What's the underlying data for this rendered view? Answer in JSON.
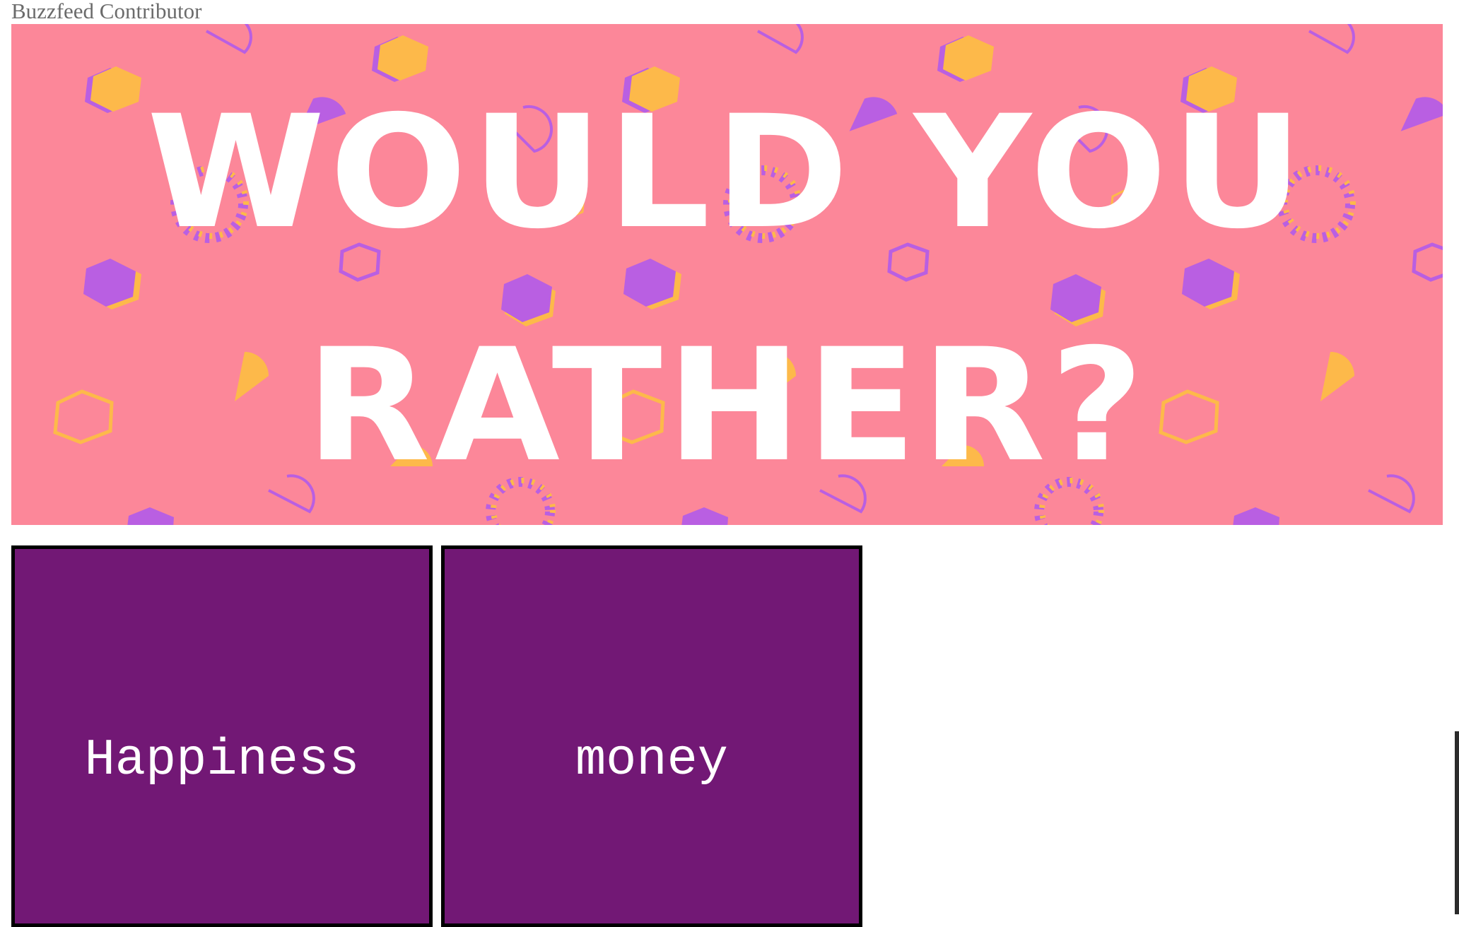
{
  "page": {
    "contributor": "Buzzfeed Contributor"
  },
  "banner": {
    "line1": "WOULD YOU",
    "line2": "RATHER?",
    "background_color": "#fc8799",
    "accent_purple": "#b95fe2",
    "accent_yellow": "#fdb94a"
  },
  "choices": [
    {
      "label": "Happiness",
      "color": "#721875"
    },
    {
      "label": "money",
      "color": "#721875"
    }
  ]
}
